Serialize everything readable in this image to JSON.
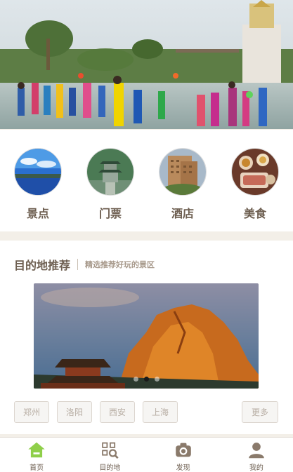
{
  "categories": [
    {
      "label": "景点",
      "icon": "lake-photo"
    },
    {
      "label": "门票",
      "icon": "pagoda-photo"
    },
    {
      "label": "酒店",
      "icon": "hotel-photo"
    },
    {
      "label": "美食",
      "icon": "food-photo"
    }
  ],
  "destination": {
    "title": "目的地推荐",
    "subtitle": "精选推荐好玩的景区",
    "carousel": {
      "slides": 3,
      "active_index": 1
    },
    "cities": [
      "郑州",
      "洛阳",
      "西安",
      "上海"
    ],
    "more_label": "更多"
  },
  "tabbar": {
    "items": [
      {
        "label": "首页",
        "icon": "home-icon",
        "active": true
      },
      {
        "label": "目的地",
        "icon": "qr-search-icon",
        "active": false
      },
      {
        "label": "发现",
        "icon": "camera-icon",
        "active": false
      },
      {
        "label": "我的",
        "icon": "user-icon",
        "active": false
      }
    ],
    "active_color": "#8fcf4a",
    "inactive_color": "#8a7a6b"
  }
}
